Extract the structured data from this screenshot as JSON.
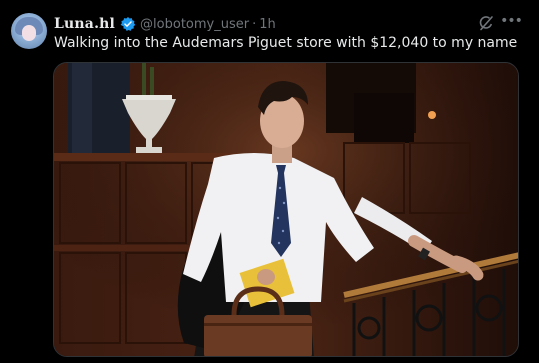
{
  "tweet": {
    "display_name": "Luna.hl",
    "handle": "@lobotomy_user",
    "separator": "·",
    "time": "1h",
    "text": "Walking into the Audemars Piguet store with $12,040 to my name",
    "more_label": "•••"
  },
  "icons": {
    "verified": "verified-badge-icon",
    "grok": "grok-icon",
    "more": "more-options-icon"
  },
  "colors": {
    "background": "#000000",
    "text_primary": "#e7e9ea",
    "text_secondary": "#71767b",
    "verified_blue": "#1d9bf0"
  }
}
